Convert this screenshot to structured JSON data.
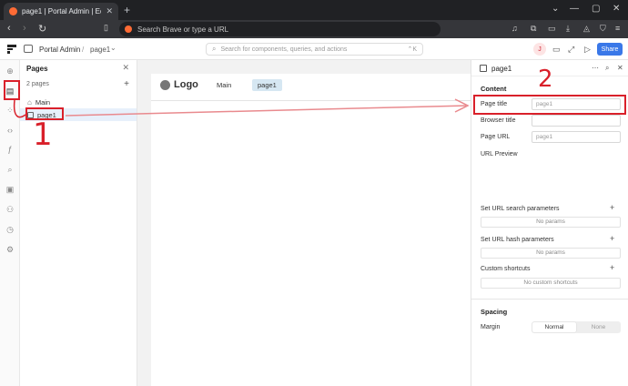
{
  "browser": {
    "tab_title": "page1 | Portal Admin | Editor | ...",
    "tab_close": "✕",
    "new_tab": "+",
    "url_placeholder": "Search Brave or type a URL",
    "window_controls": [
      "⌄",
      "—",
      "▢",
      "✕"
    ]
  },
  "app": {
    "breadcrumb_app": "Portal Admin",
    "breadcrumb_sep": "/",
    "breadcrumb_page": "page1",
    "breadcrumb_chevron": "⌄",
    "search_placeholder": "Search for components, queries, and actions",
    "search_shortcut": "⌃K",
    "avatar_initial": "J",
    "share_label": "Share"
  },
  "pages_panel": {
    "title": "Pages",
    "close": "✕",
    "count": "2 pages",
    "add": "+",
    "items": [
      {
        "label": "Main"
      },
      {
        "label": "page1"
      }
    ]
  },
  "canvas": {
    "logo_text": "Logo",
    "nav": [
      "Main",
      "page1"
    ]
  },
  "props": {
    "title": "page1",
    "more": "⋯",
    "content_title": "Content",
    "page_title_label": "Page title",
    "page_title_placeholder": "page1",
    "browser_title_label": "Browser title",
    "page_url_label": "Page URL",
    "page_url_placeholder": "page1",
    "url_preview_label": "URL Preview",
    "url_search_label": "Set URL search parameters",
    "url_search_empty": "No params",
    "url_hash_label": "Set URL hash parameters",
    "url_hash_empty": "No params",
    "shortcuts_label": "Custom shortcuts",
    "shortcuts_empty": "No custom shortcuts",
    "plus": "+",
    "spacing_title": "Spacing",
    "margin_label": "Margin",
    "margin_options": [
      "Normal",
      "None"
    ]
  },
  "annotations": {
    "num1": "1",
    "num2": "2",
    "color": "#d9202a"
  }
}
